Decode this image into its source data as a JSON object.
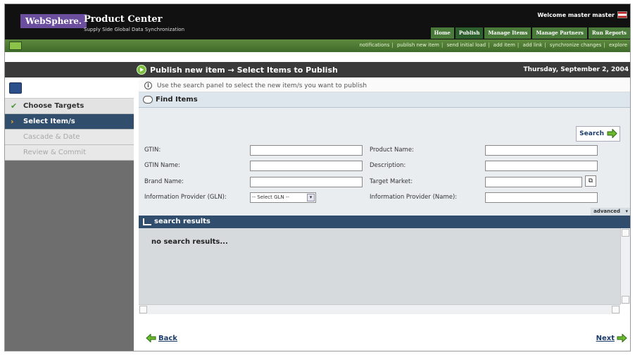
{
  "header": {
    "logo_text": "WebSphere.",
    "product_title": "Product Center",
    "product_subtitle": "Supply Side Global Data Synchronization",
    "welcome": "Welcome  master master"
  },
  "main_tabs": [
    {
      "label": "Home"
    },
    {
      "label": "Publish"
    },
    {
      "label": "Manage Items"
    },
    {
      "label": "Manage Partners"
    },
    {
      "label": "Run Reports"
    }
  ],
  "subnav": {
    "links": [
      "notifications",
      "publish new item",
      "send initial load",
      "add item",
      "add link",
      "synchronize changes",
      "explore"
    ]
  },
  "title": {
    "text": "Publish new item  →  Select Items to Publish",
    "date": "Thursday, September 2, 2004"
  },
  "wizard": {
    "steps": [
      {
        "label": "Choose Targets"
      },
      {
        "label": "Select Item/s"
      },
      {
        "label": "Cascade & Date"
      },
      {
        "label": "Review & Commit"
      }
    ]
  },
  "info_message": "Use the search panel to select the new item/s you want to publish",
  "find": {
    "title": "Find Items",
    "search_label": "Search",
    "fields": {
      "gtin": "GTIN:",
      "gtin_name": "GTIN Name:",
      "brand_name": "Brand Name:",
      "info_provider_gln": "Information Provider (GLN):",
      "product_name": "Product Name:",
      "description": "Description:",
      "target_market": "Target Market:",
      "info_provider_name": "Information Provider (Name):"
    },
    "gln_select_value": "-- Select GLN --",
    "advanced_label": "advanced"
  },
  "results": {
    "title": "search results",
    "empty_text": "no search results..."
  },
  "footer": {
    "back_label": "Back",
    "next_label": "Next"
  }
}
